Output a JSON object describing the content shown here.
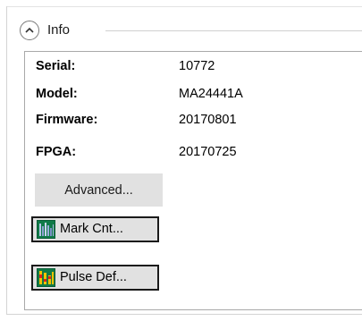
{
  "group": {
    "title": "Info",
    "collapse_icon": "chevron-up-icon"
  },
  "info": {
    "rows": [
      {
        "label": "Serial:",
        "value": "10772"
      },
      {
        "label": "Model:",
        "value": "MA24441A"
      },
      {
        "label": "Firmware:",
        "value": "20170801"
      },
      {
        "label": "FPGA:",
        "value": "20170725"
      }
    ]
  },
  "buttons": {
    "advanced_label": "Advanced...",
    "mark_cnt_label": "Mark Cnt...",
    "mark_cnt_icon": "mark-count-icon",
    "pulse_def_label": "Pulse Def...",
    "pulse_def_icon": "pulse-definition-icon"
  },
  "colors": {
    "button_face": "#e1e1e1",
    "panel_border": "#a9a9a9"
  }
}
